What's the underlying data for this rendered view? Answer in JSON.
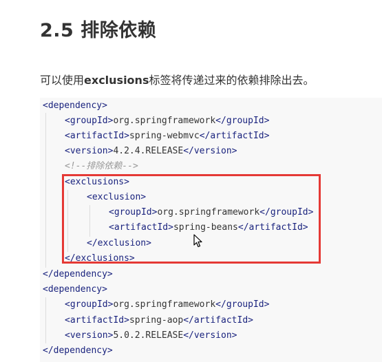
{
  "heading": "2.5 排除依赖",
  "paragraph": {
    "prefix": "可以使用",
    "keyword": "exclusions",
    "suffix": "标签将传递过来的依赖排除出去。"
  },
  "code": {
    "dependency_open": "dependency",
    "dependency_close": "/dependency",
    "groupId_open": "groupId",
    "groupId_close": "/groupId",
    "artifactId_open": "artifactId",
    "artifactId_close": "/artifactId",
    "version_open": "version",
    "version_close": "/version",
    "exclusions_open": "exclusions",
    "exclusions_close": "/exclusions",
    "exclusion_open": "exclusion",
    "exclusion_close": "/exclusion",
    "dep1_group": "org.springframework",
    "dep1_artifact": "spring-webmvc",
    "dep1_version": "4.2.4.RELEASE",
    "comment": "<!--排除依赖-->",
    "excl_group": "org.springframework",
    "excl_artifact": "spring-beans",
    "dep2_group": "org.springframework",
    "dep2_artifact": "spring-aop",
    "dep2_version": "5.0.2.RELEASE"
  }
}
